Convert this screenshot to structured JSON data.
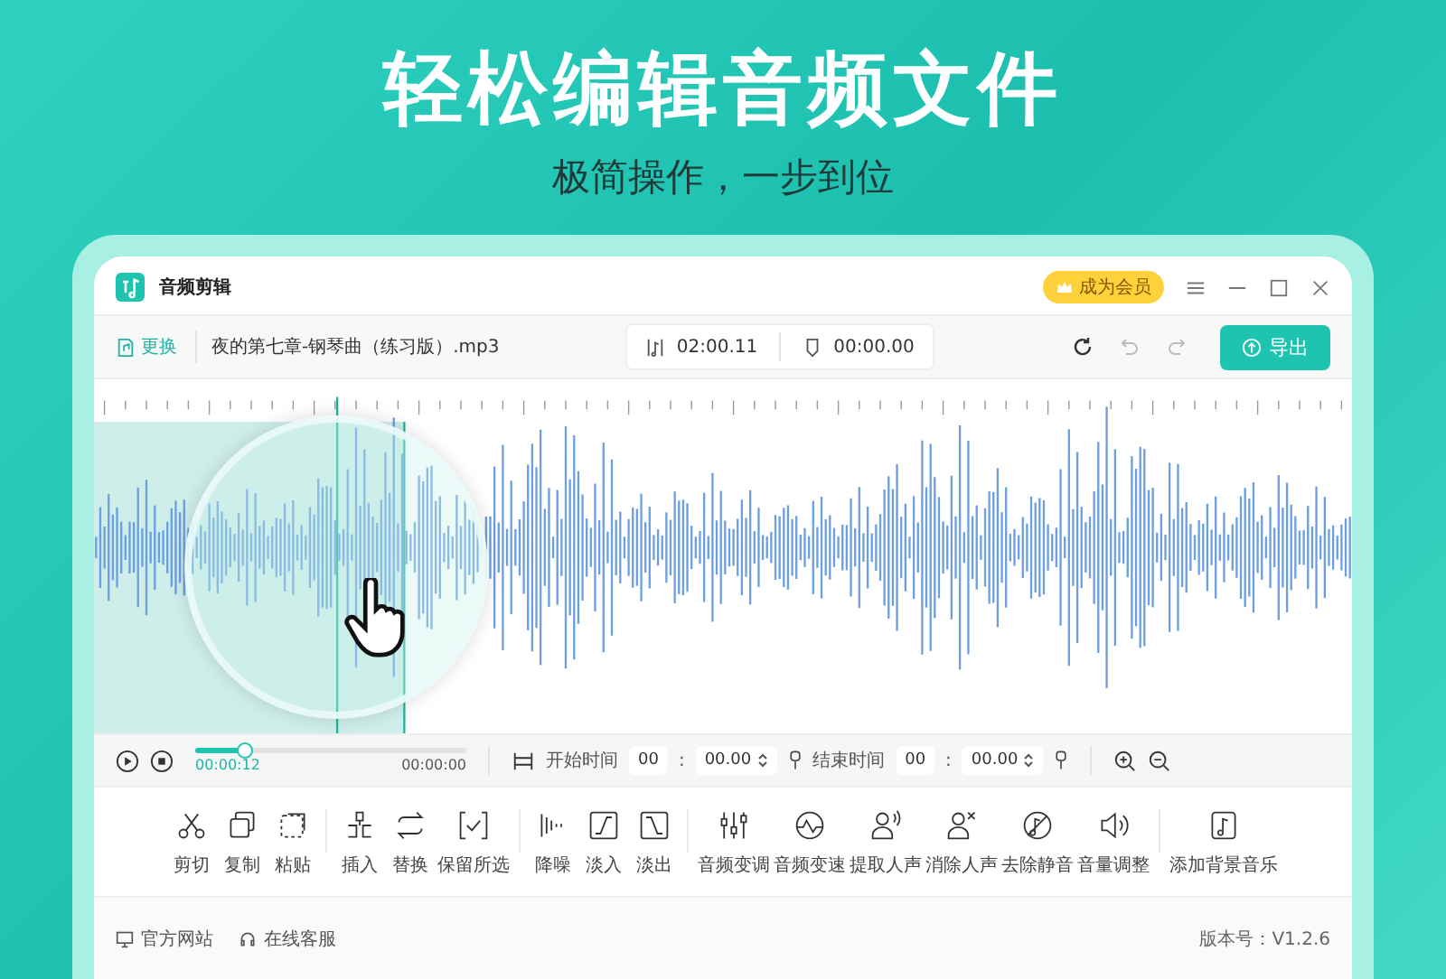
{
  "headline": "轻松编辑音频文件",
  "subheadline": "极简操作，一步到位",
  "app": {
    "title": "音频剪辑",
    "vip_badge": "成为会员",
    "file_bar": {
      "replace": "更换",
      "file_name": "夜的第七章-钢琴曲（练习版）.mp3",
      "duration": "02:00.11",
      "position": "00:00.00",
      "export": "导出"
    },
    "playback": {
      "level": 0.18,
      "current": "00:00:12",
      "total": "00:00:00"
    },
    "range": [
      {
        "label": "开始时间",
        "minutes": "00",
        "separator": ":",
        "seconds": "00.00"
      },
      {
        "label": "结束时间",
        "minutes": "00",
        "separator": ":",
        "seconds": "00.00"
      }
    ],
    "tool_groups": [
      [
        {
          "kind": "cut",
          "label": "剪切"
        },
        {
          "kind": "copy",
          "label": "复制"
        },
        {
          "kind": "paste",
          "label": "粘贴"
        }
      ],
      [
        {
          "kind": "insert",
          "label": "插入"
        },
        {
          "kind": "replace",
          "label": "替换"
        },
        {
          "kind": "keep",
          "label": "保留所选"
        }
      ],
      [
        {
          "kind": "denoise",
          "label": "降噪"
        },
        {
          "kind": "fadein",
          "label": "淡入"
        },
        {
          "kind": "fadeout",
          "label": "淡出"
        }
      ],
      [
        {
          "kind": "eq",
          "label": "音频变调"
        },
        {
          "kind": "speed",
          "label": "音频变速"
        },
        {
          "kind": "voice",
          "label": "提取人声"
        },
        {
          "kind": "novoice",
          "label": "消除人声"
        },
        {
          "kind": "silence",
          "label": "去除静音"
        },
        {
          "kind": "volume",
          "label": "音量调整"
        }
      ],
      [
        {
          "kind": "music",
          "label": "添加背景音乐"
        }
      ]
    ],
    "footer": {
      "links": [
        "官方网站",
        "在线客服"
      ],
      "version": "版本号：V1.2.6"
    }
  }
}
